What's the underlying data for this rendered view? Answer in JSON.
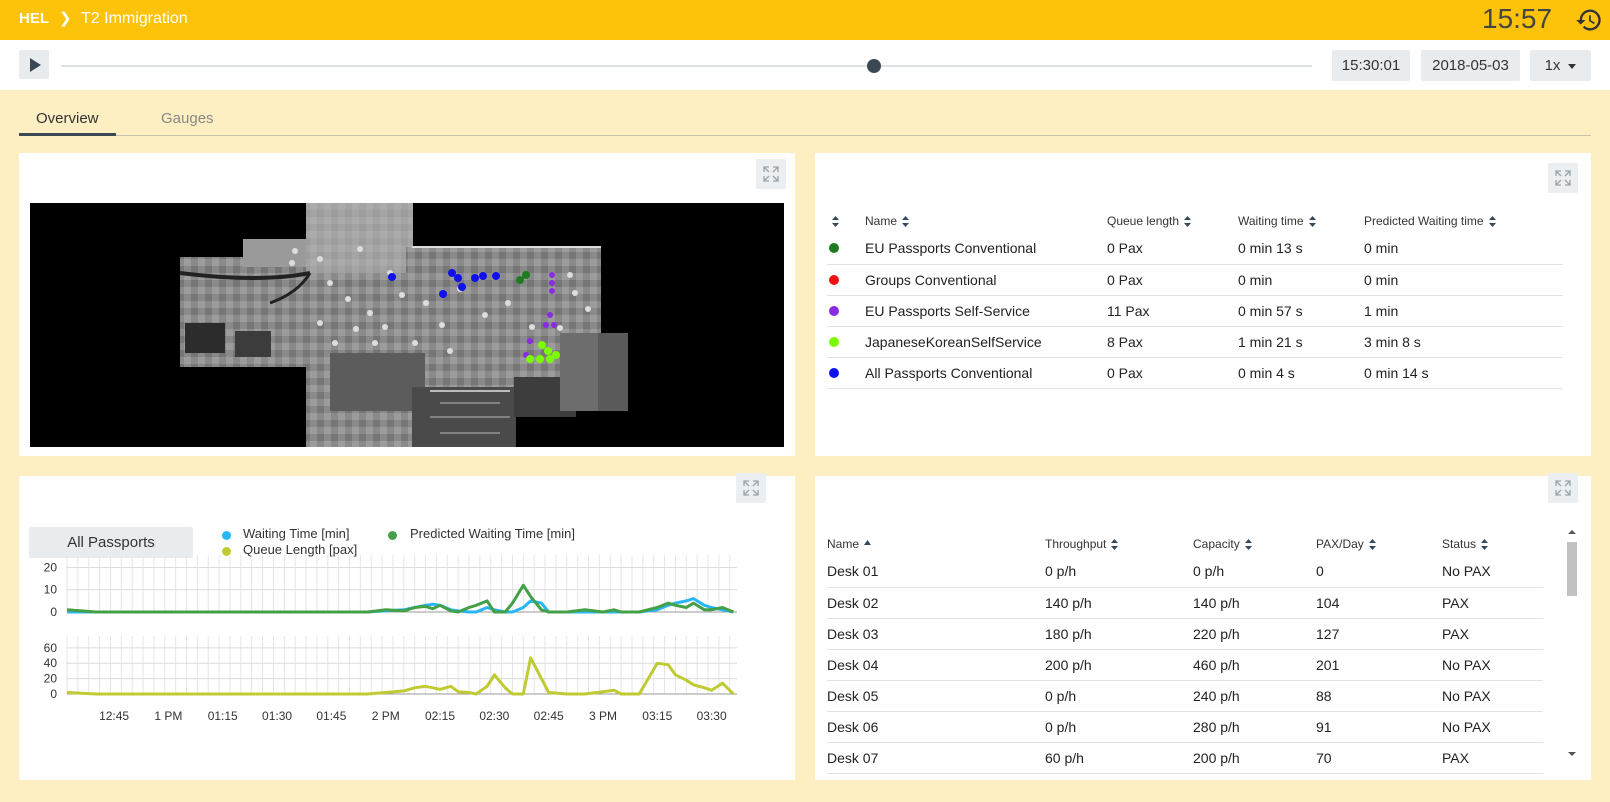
{
  "breadcrumb": {
    "root": "HEL",
    "separator": "❯",
    "title": "T2 Immigration"
  },
  "clock": "15:57",
  "playback": {
    "time": "15:30:01",
    "date": "2018-05-03",
    "speed": "1x",
    "progress": 0.65
  },
  "tabs": [
    {
      "label": "Overview",
      "active": true
    },
    {
      "label": "Gauges",
      "active": false
    }
  ],
  "queues": {
    "headers": [
      "Name",
      "Queue length",
      "Waiting time",
      "Predicted Waiting time"
    ],
    "rows": [
      {
        "color": "#1e7c1e",
        "name": "EU Passports Conventional",
        "queue": "0 Pax",
        "wait": "0 min 13 s",
        "pred": "0 min"
      },
      {
        "color": "#ee1111",
        "name": "Groups Conventional",
        "queue": "0 Pax",
        "wait": "0 min",
        "pred": "0 min"
      },
      {
        "color": "#8a2be2",
        "name": "EU Passports Self-Service",
        "queue": "11 Pax",
        "wait": "0 min 57 s",
        "pred": "1 min"
      },
      {
        "color": "#7cfc00",
        "name": "JapaneseKoreanSelfService",
        "queue": "8 Pax",
        "wait": "1 min 21 s",
        "pred": "3 min 8 s"
      },
      {
        "color": "#1010ee",
        "name": "All Passports Conventional",
        "queue": "0 Pax",
        "wait": "0 min 4 s",
        "pred": "0 min 14 s"
      }
    ]
  },
  "chart_panel": {
    "selector": "All Passports",
    "legend": [
      {
        "label": "Waiting Time [min]",
        "color": "#29b6f6"
      },
      {
        "label": "Predicted Waiting Time [min]",
        "color": "#43a047"
      },
      {
        "label": "Queue Length [pax]",
        "color": "#c0ca33"
      }
    ]
  },
  "chart_data": {
    "type": "line",
    "x_tick_labels": [
      "12:45",
      "1 PM",
      "01:15",
      "01:30",
      "01:45",
      "2 PM",
      "02:15",
      "02:30",
      "02:45",
      "3 PM",
      "03:15",
      "03:30"
    ],
    "x": [
      "12:32",
      "12:40",
      "12:50",
      "13:00",
      "13:20",
      "13:40",
      "13:55",
      "14:00",
      "14:05",
      "14:08",
      "14:11",
      "14:13",
      "14:15",
      "14:18",
      "14:20",
      "14:23",
      "14:25",
      "14:28",
      "14:30",
      "14:33",
      "14:35",
      "14:38",
      "14:40",
      "14:43",
      "14:45",
      "14:50",
      "14:55",
      "15:00",
      "15:03",
      "15:05",
      "15:10",
      "15:15",
      "15:18",
      "15:20",
      "15:23",
      "15:25",
      "15:28",
      "15:30",
      "15:33",
      "15:36"
    ],
    "panels": [
      {
        "yticks": [
          0,
          10,
          20
        ],
        "ylim": [
          0,
          22
        ],
        "series": [
          {
            "name": "Waiting Time [min]",
            "color": "#29b6f6",
            "values": [
              0,
              0,
              0,
              0,
              0,
              0,
              0,
              0.5,
              1,
              2,
              3,
              3.5,
              3,
              1,
              0.5,
              0,
              0,
              2,
              1,
              0,
              0,
              2,
              5,
              4,
              0,
              0,
              0,
              0,
              0,
              0,
              0,
              1,
              3,
              4,
              5,
              6,
              3,
              2,
              1,
              0
            ]
          },
          {
            "name": "Predicted Waiting Time [min]",
            "color": "#43a047",
            "values": [
              1,
              0,
              0,
              0,
              0,
              0,
              0,
              1,
              0.5,
              2,
              2.5,
              1.5,
              3,
              0.5,
              0,
              2,
              3,
              5,
              0,
              0,
              4,
              12,
              7,
              1,
              0,
              0,
              1,
              0,
              1,
              0,
              0,
              2,
              4,
              3,
              2,
              4,
              1,
              1,
              2,
              0
            ]
          }
        ]
      },
      {
        "yticks": [
          0,
          20,
          40,
          60
        ],
        "ylim": [
          0,
          65
        ],
        "series": [
          {
            "name": "Queue Length [pax]",
            "color": "#c0ca33",
            "values": [
              2,
              0,
              0,
              0,
              0,
              0,
              0,
              2,
              4,
              8,
              10,
              8,
              6,
              10,
              3,
              2,
              0,
              10,
              25,
              8,
              0,
              0,
              47,
              20,
              2,
              0,
              0,
              3,
              5,
              0,
              0,
              40,
              38,
              25,
              18,
              12,
              8,
              5,
              14,
              0
            ]
          }
        ]
      }
    ]
  },
  "desks": {
    "headers": [
      "Name",
      "Throughput",
      "Capacity",
      "PAX/Day",
      "Status"
    ],
    "rows": [
      {
        "name": "Desk 01",
        "throughput": "0 p/h",
        "capacity": "0 p/h",
        "pax": "0",
        "status": "No PAX"
      },
      {
        "name": "Desk 02",
        "throughput": "140 p/h",
        "capacity": "140 p/h",
        "pax": "104",
        "status": "PAX"
      },
      {
        "name": "Desk 03",
        "throughput": "180 p/h",
        "capacity": "220 p/h",
        "pax": "127",
        "status": "PAX"
      },
      {
        "name": "Desk 04",
        "throughput": "200 p/h",
        "capacity": "460 p/h",
        "pax": "201",
        "status": "No PAX"
      },
      {
        "name": "Desk 05",
        "throughput": "0 p/h",
        "capacity": "240 p/h",
        "pax": "88",
        "status": "No PAX"
      },
      {
        "name": "Desk 06",
        "throughput": "0 p/h",
        "capacity": "280 p/h",
        "pax": "91",
        "status": "No PAX"
      },
      {
        "name": "Desk 07",
        "throughput": "60 p/h",
        "capacity": "200 p/h",
        "pax": "70",
        "status": "PAX"
      }
    ]
  },
  "icons": {
    "history": "history-icon",
    "play": "play-icon",
    "expand": "expand-icon",
    "sort": "sort-icon",
    "caret": "caret-down-icon"
  }
}
